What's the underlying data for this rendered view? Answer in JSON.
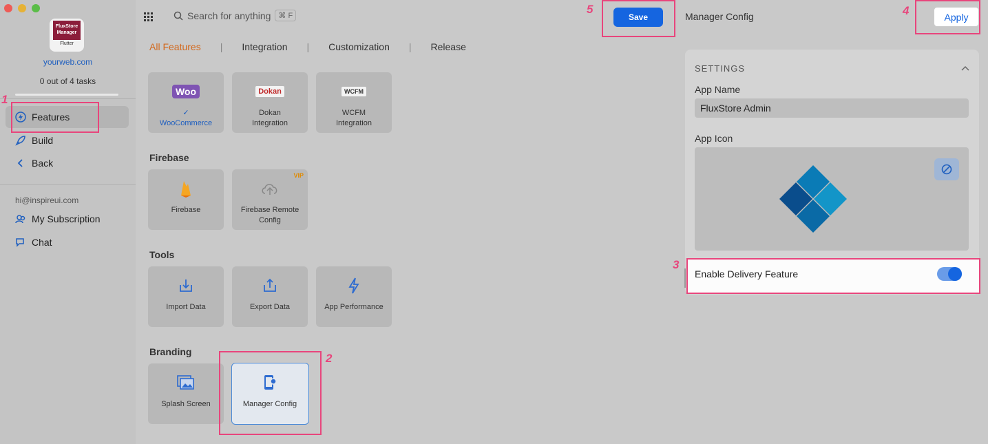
{
  "sidebar": {
    "logo_text": "FluxStore Manager",
    "logo_sub": "Flutter",
    "site": "yourweb.com",
    "tasks": "0 out of 4 tasks",
    "items": [
      {
        "label": "Features",
        "icon": "bolt-icon"
      },
      {
        "label": "Build",
        "icon": "rocket-icon"
      },
      {
        "label": "Back",
        "icon": "chevron-left-icon"
      }
    ],
    "email": "hi@inspireui.com",
    "account_items": [
      {
        "label": "My Subscription",
        "icon": "user-group-icon"
      },
      {
        "label": "Chat",
        "icon": "chat-icon"
      }
    ]
  },
  "header": {
    "search_placeholder": "Search for anything",
    "search_shortcut": "⌘ F",
    "save_label": "Save"
  },
  "tabs": [
    {
      "label": "All Features",
      "active": true
    },
    {
      "label": "Integration",
      "active": false
    },
    {
      "label": "Customization",
      "active": false
    },
    {
      "label": "Release",
      "active": false
    }
  ],
  "sections": {
    "integrations": [
      {
        "label": "✓\nWooCommerce",
        "check": "✓",
        "name": "WooCommerce",
        "logo": "Woo"
      },
      {
        "label": "Dokan Integration",
        "name": "Dokan\nIntegration",
        "logo": "Dokan"
      },
      {
        "label": "WCFM Integration",
        "name": "WCFM\nIntegration",
        "logo": "WCFM"
      }
    ],
    "firebase_title": "Firebase",
    "firebase": [
      {
        "name": "Firebase"
      },
      {
        "name": "Firebase Remote Config",
        "badge": "VIP"
      }
    ],
    "tools_title": "Tools",
    "tools": [
      {
        "name": "Import Data"
      },
      {
        "name": "Export Data"
      },
      {
        "name": "App Performance"
      }
    ],
    "branding_title": "Branding",
    "branding": [
      {
        "name": "Splash Screen"
      },
      {
        "name": "Manager Config"
      }
    ]
  },
  "right": {
    "title": "Manager Config",
    "apply_label": "Apply",
    "settings_label": "SETTINGS",
    "app_name_label": "App Name",
    "app_name_value": "FluxStore Admin",
    "app_icon_label": "App Icon",
    "delivery_label": "Enable Delivery Feature",
    "delivery_enabled": true
  },
  "annotations": [
    "1",
    "2",
    "3",
    "4",
    "5"
  ],
  "colors": {
    "accent": "#1565e0",
    "highlight": "#e8457c",
    "active_tab": "#d2691e"
  }
}
